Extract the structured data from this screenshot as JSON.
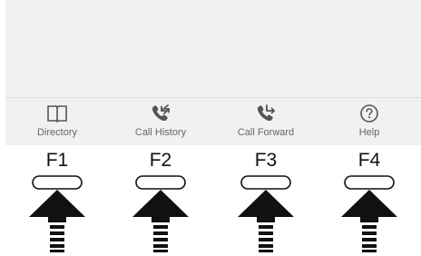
{
  "softkeys": [
    {
      "label": "Directory",
      "icon": "book-icon"
    },
    {
      "label": "Call History",
      "icon": "call-history-icon"
    },
    {
      "label": "Call Forward",
      "icon": "call-forward-icon"
    },
    {
      "label": "Help",
      "icon": "help-icon"
    }
  ],
  "function_keys": [
    {
      "label": "F1"
    },
    {
      "label": "F2"
    },
    {
      "label": "F3"
    },
    {
      "label": "F4"
    }
  ],
  "colors": {
    "screen_bg": "#f1f1f1",
    "icon": "#555555",
    "label": "#666666",
    "arrow": "#111111"
  }
}
